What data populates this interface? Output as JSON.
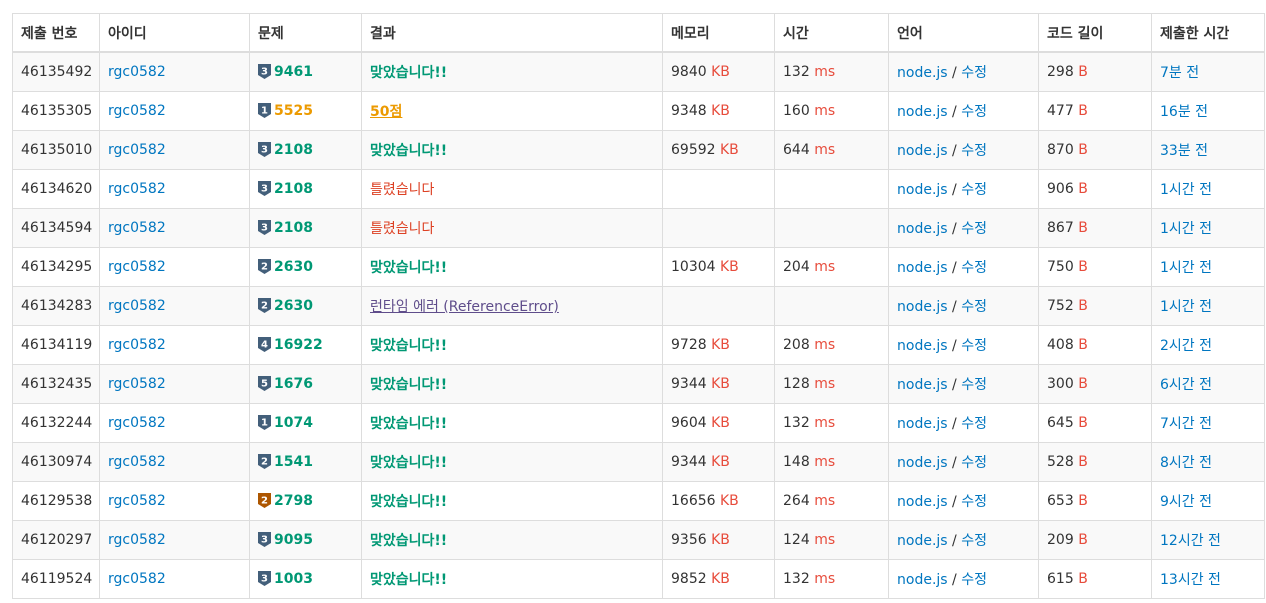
{
  "headers": {
    "submission_id": "제출 번호",
    "user": "아이디",
    "problem": "문제",
    "result": "결과",
    "memory": "메모리",
    "time": "시간",
    "language": "언어",
    "code_length": "코드 길이",
    "submitted_at": "제출한 시간"
  },
  "units": {
    "memory": "KB",
    "time": "ms",
    "length": "B"
  },
  "edit_separator": "/",
  "colors": {
    "accepted": "#009874",
    "partial": "#ec9a00",
    "wrong": "#dd4124",
    "runtime_error": "#5f4d8b",
    "link": "#0076c0",
    "unit": "#e74c3c",
    "tier_silver": "#435f7a",
    "tier_bronze": "#ad5600"
  },
  "rows": [
    {
      "id": "46135492",
      "user": "rgc0582",
      "tier": "silver",
      "tier_level": "3",
      "problem": "9461",
      "result": "맞았습니다!!",
      "result_type": "ac",
      "memory": "9840",
      "time": "132",
      "lang": "node.js",
      "edit": "수정",
      "length": "298",
      "submitted": "7분 전"
    },
    {
      "id": "46135305",
      "user": "rgc0582",
      "tier": "silver",
      "tier_level": "1",
      "problem": "5525",
      "result": "50점",
      "result_type": "partial",
      "memory": "9348",
      "time": "160",
      "lang": "node.js",
      "edit": "수정",
      "length": "477",
      "submitted": "16분 전"
    },
    {
      "id": "46135010",
      "user": "rgc0582",
      "tier": "silver",
      "tier_level": "3",
      "problem": "2108",
      "result": "맞았습니다!!",
      "result_type": "ac",
      "memory": "69592",
      "time": "644",
      "lang": "node.js",
      "edit": "수정",
      "length": "870",
      "submitted": "33분 전"
    },
    {
      "id": "46134620",
      "user": "rgc0582",
      "tier": "silver",
      "tier_level": "3",
      "problem": "2108",
      "result": "틀렸습니다",
      "result_type": "wa",
      "memory": "",
      "time": "",
      "lang": "node.js",
      "edit": "수정",
      "length": "906",
      "submitted": "1시간 전"
    },
    {
      "id": "46134594",
      "user": "rgc0582",
      "tier": "silver",
      "tier_level": "3",
      "problem": "2108",
      "result": "틀렸습니다",
      "result_type": "wa",
      "memory": "",
      "time": "",
      "lang": "node.js",
      "edit": "수정",
      "length": "867",
      "submitted": "1시간 전"
    },
    {
      "id": "46134295",
      "user": "rgc0582",
      "tier": "silver",
      "tier_level": "2",
      "problem": "2630",
      "result": "맞았습니다!!",
      "result_type": "ac",
      "memory": "10304",
      "time": "204",
      "lang": "node.js",
      "edit": "수정",
      "length": "750",
      "submitted": "1시간 전"
    },
    {
      "id": "46134283",
      "user": "rgc0582",
      "tier": "silver",
      "tier_level": "2",
      "problem": "2630",
      "result": "런타임 에러 (ReferenceError)",
      "result_type": "rte",
      "memory": "",
      "time": "",
      "lang": "node.js",
      "edit": "수정",
      "length": "752",
      "submitted": "1시간 전"
    },
    {
      "id": "46134119",
      "user": "rgc0582",
      "tier": "silver",
      "tier_level": "4",
      "problem": "16922",
      "result": "맞았습니다!!",
      "result_type": "ac",
      "memory": "9728",
      "time": "208",
      "lang": "node.js",
      "edit": "수정",
      "length": "408",
      "submitted": "2시간 전"
    },
    {
      "id": "46132435",
      "user": "rgc0582",
      "tier": "silver",
      "tier_level": "5",
      "problem": "1676",
      "result": "맞았습니다!!",
      "result_type": "ac",
      "memory": "9344",
      "time": "128",
      "lang": "node.js",
      "edit": "수정",
      "length": "300",
      "submitted": "6시간 전"
    },
    {
      "id": "46132244",
      "user": "rgc0582",
      "tier": "silver",
      "tier_level": "1",
      "problem": "1074",
      "result": "맞았습니다!!",
      "result_type": "ac",
      "memory": "9604",
      "time": "132",
      "lang": "node.js",
      "edit": "수정",
      "length": "645",
      "submitted": "7시간 전"
    },
    {
      "id": "46130974",
      "user": "rgc0582",
      "tier": "silver",
      "tier_level": "2",
      "problem": "1541",
      "result": "맞았습니다!!",
      "result_type": "ac",
      "memory": "9344",
      "time": "148",
      "lang": "node.js",
      "edit": "수정",
      "length": "528",
      "submitted": "8시간 전"
    },
    {
      "id": "46129538",
      "user": "rgc0582",
      "tier": "bronze",
      "tier_level": "2",
      "problem": "2798",
      "result": "맞았습니다!!",
      "result_type": "ac",
      "memory": "16656",
      "time": "264",
      "lang": "node.js",
      "edit": "수정",
      "length": "653",
      "submitted": "9시간 전"
    },
    {
      "id": "46120297",
      "user": "rgc0582",
      "tier": "silver",
      "tier_level": "3",
      "problem": "9095",
      "result": "맞았습니다!!",
      "result_type": "ac",
      "memory": "9356",
      "time": "124",
      "lang": "node.js",
      "edit": "수정",
      "length": "209",
      "submitted": "12시간 전"
    },
    {
      "id": "46119524",
      "user": "rgc0582",
      "tier": "silver",
      "tier_level": "3",
      "problem": "1003",
      "result": "맞았습니다!!",
      "result_type": "ac",
      "memory": "9852",
      "time": "132",
      "lang": "node.js",
      "edit": "수정",
      "length": "615",
      "submitted": "13시간 전"
    }
  ]
}
